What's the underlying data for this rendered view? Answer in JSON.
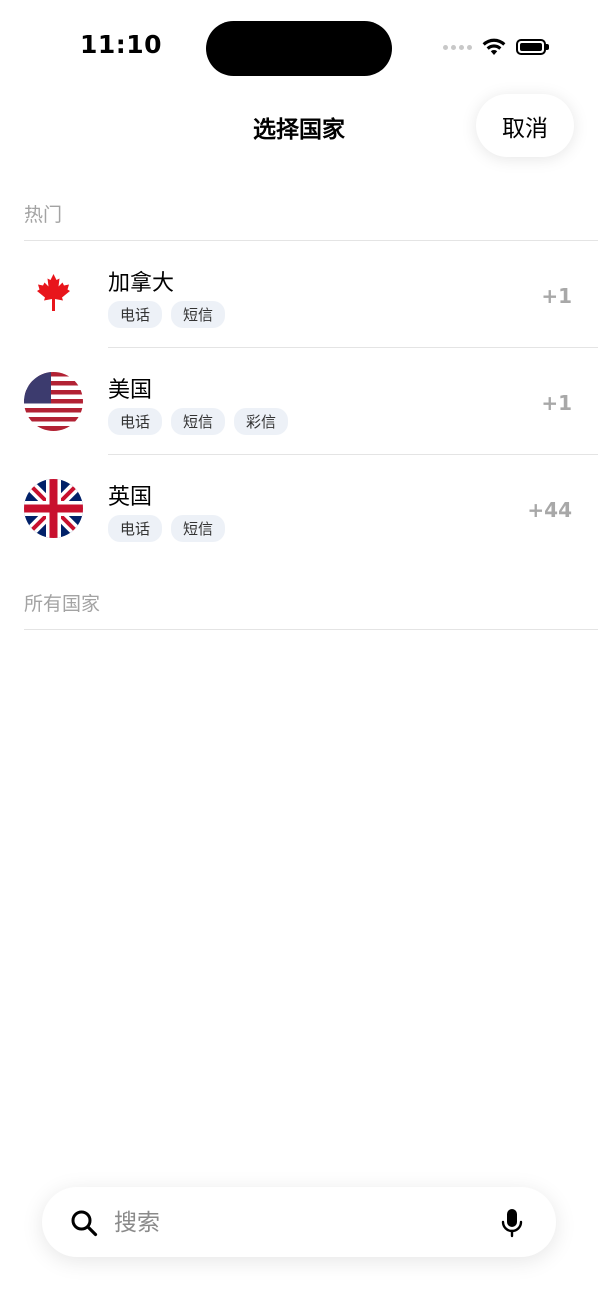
{
  "status_bar": {
    "time": "11:10"
  },
  "header": {
    "title": "选择国家",
    "cancel_label": "取消"
  },
  "sections": {
    "popular_label": "热门",
    "all_label": "所有国家"
  },
  "countries": [
    {
      "name": "加拿大",
      "code": "+1",
      "tags": [
        "电话",
        "短信"
      ],
      "flag": "canada-flag-icon"
    },
    {
      "name": "美国",
      "code": "+1",
      "tags": [
        "电话",
        "短信",
        "彩信"
      ],
      "flag": "usa-flag-icon"
    },
    {
      "name": "英国",
      "code": "+44",
      "tags": [
        "电话",
        "短信"
      ],
      "flag": "uk-flag-icon"
    }
  ],
  "search": {
    "placeholder": "搜索"
  },
  "colors": {
    "section_label": "#a3a3a3",
    "tag_background": "#edf1f7",
    "code_text": "#a8a8a8",
    "divider": "#e4e4e4"
  }
}
